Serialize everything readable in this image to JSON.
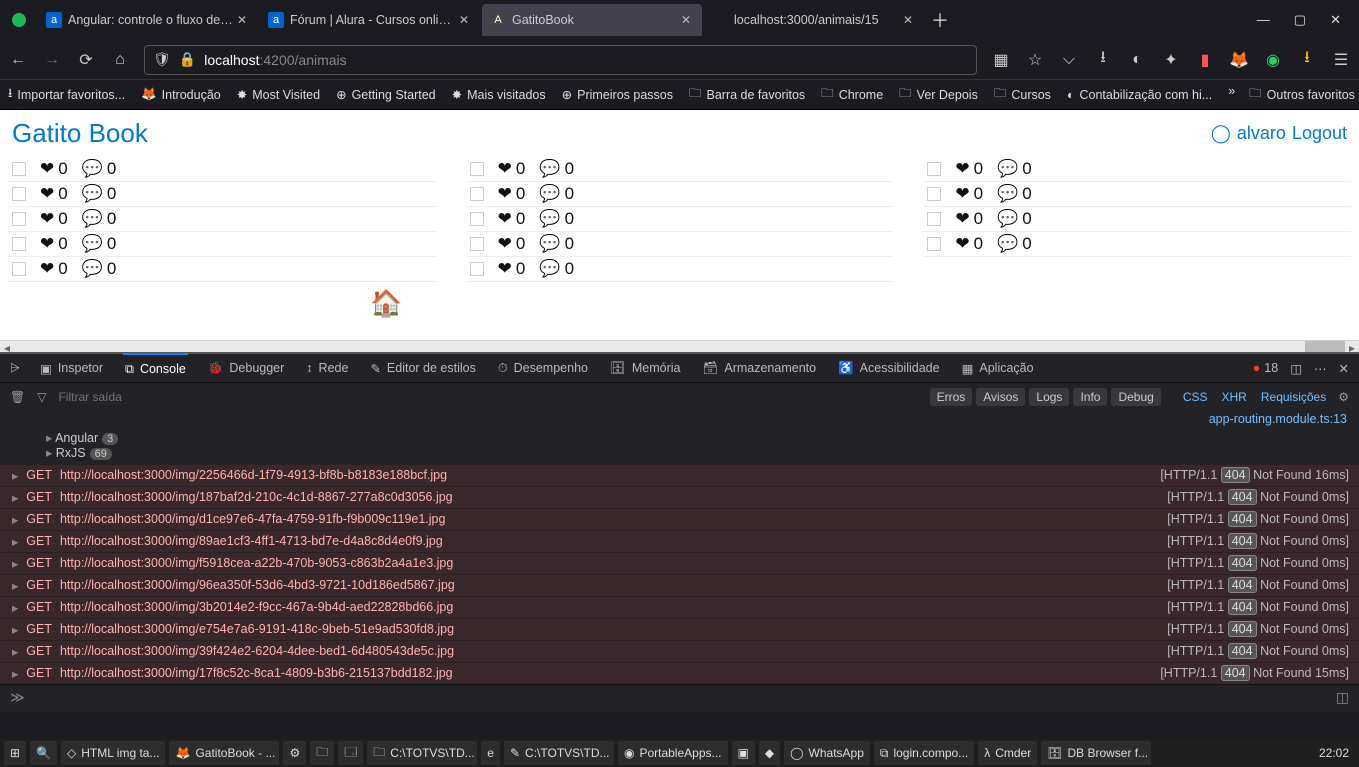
{
  "tabs": [
    {
      "title": "Angular: controle o fluxo de na…",
      "fav": "a",
      "favbg": "#0066cc"
    },
    {
      "title": "Fórum | Alura - Cursos online d…",
      "fav": "a",
      "favbg": "#0066cc"
    },
    {
      "title": "GatitoBook",
      "fav": "A",
      "favbg": "#444",
      "active": true
    },
    {
      "title": "localhost:3000/animais/15",
      "fav": "",
      "favbg": "transparent"
    }
  ],
  "url": {
    "host": "localhost",
    "port": ":4200",
    "path": "/animais"
  },
  "bookmarks": [
    {
      "icon": "⭳",
      "label": "Importar favoritos..."
    },
    {
      "icon": "🦊",
      "label": "Introdução"
    },
    {
      "icon": "✸",
      "label": "Most Visited"
    },
    {
      "icon": "⊕",
      "label": "Getting Started"
    },
    {
      "icon": "✸",
      "label": "Mais visitados"
    },
    {
      "icon": "⊕",
      "label": "Primeiros passos"
    },
    {
      "icon": "🗀",
      "label": "Barra de favoritos"
    },
    {
      "icon": "🗀",
      "label": "Chrome"
    },
    {
      "icon": "🗀",
      "label": "Ver Depois"
    },
    {
      "icon": "🗀",
      "label": "Cursos"
    },
    {
      "icon": "◐",
      "label": "Contabilização com hi..."
    }
  ],
  "bookmarks_right": {
    "more": "»",
    "other": "Outros favoritos"
  },
  "page": {
    "brand": "Gatito Book",
    "user": "alvaro",
    "logout": "Logout",
    "col_counts": [
      5,
      5,
      4
    ],
    "like": "0",
    "comment": "0"
  },
  "devtools": {
    "tabs": [
      "Inspetor",
      "Console",
      "Debugger",
      "Rede",
      "Editor de estilos",
      "Desempenho",
      "Memória",
      "Armazenamento",
      "Acessibilidade",
      "Aplicação"
    ],
    "active": "Console",
    "error_count": "18",
    "filter_placeholder": "Filtrar saída",
    "pills": [
      "Erros",
      "Avisos",
      "Logs",
      "Info",
      "Debug"
    ],
    "links": [
      "CSS",
      "XHR",
      "Requisições"
    ],
    "tree": [
      {
        "label": "Angular",
        "count": "3"
      },
      {
        "label": "RxJS",
        "count": "69"
      }
    ],
    "source_hint": "app-routing.module.ts:13",
    "rows": [
      {
        "url": "http://localhost:3000/img/2256466d-1f79-4913-bf8b-b8183e188bcf.jpg",
        "time": "16ms"
      },
      {
        "url": "http://localhost:3000/img/187baf2d-210c-4c1d-8867-277a8c0d3056.jpg",
        "time": "0ms"
      },
      {
        "url": "http://localhost:3000/img/d1ce97e6-47fa-4759-91fb-f9b009c119e1.jpg",
        "time": "0ms"
      },
      {
        "url": "http://localhost:3000/img/89ae1cf3-4ff1-4713-bd7e-d4a8c8d4e0f9.jpg",
        "time": "0ms"
      },
      {
        "url": "http://localhost:3000/img/f5918cea-a22b-470b-9053-c863b2a4a1e3.jpg",
        "time": "0ms"
      },
      {
        "url": "http://localhost:3000/img/96ea350f-53d6-4bd3-9721-10d186ed5867.jpg",
        "time": "0ms"
      },
      {
        "url": "http://localhost:3000/img/3b2014e2-f9cc-467a-9b4d-aed22828bd66.jpg",
        "time": "0ms"
      },
      {
        "url": "http://localhost:3000/img/e754e7a6-9191-418c-9beb-51e9ad530fd8.jpg",
        "time": "0ms"
      },
      {
        "url": "http://localhost:3000/img/39f424e2-6204-4dee-bed1-6d480543de5c.jpg",
        "time": "0ms"
      },
      {
        "url": "http://localhost:3000/img/17f8c52c-8ca1-4809-b3b6-215137bdd182.jpg",
        "time": "15ms"
      }
    ],
    "method": "GET",
    "proto": "[HTTP/1.1",
    "code": "404",
    "status": "Not Found",
    "end": "]"
  },
  "taskbar": {
    "items": [
      {
        "icon": "⊞",
        "label": ""
      },
      {
        "icon": "🔍",
        "label": ""
      },
      {
        "icon": "◇",
        "label": "HTML img ta..."
      },
      {
        "icon": "🦊",
        "label": "GatitoBook - ..."
      },
      {
        "icon": "⚙",
        "label": ""
      },
      {
        "icon": "🗀",
        "label": ""
      },
      {
        "icon": "🗔",
        "label": ""
      },
      {
        "icon": "🗀",
        "label": "C:\\TOTVS\\TD..."
      },
      {
        "icon": "e",
        "label": ""
      },
      {
        "icon": "✎",
        "label": "C:\\TOTVS\\TD..."
      },
      {
        "icon": "◉",
        "label": "PortableApps..."
      },
      {
        "icon": "▣",
        "label": ""
      },
      {
        "icon": "◆",
        "label": ""
      },
      {
        "icon": "◯",
        "label": "WhatsApp"
      },
      {
        "icon": "⧉",
        "label": "login.compo..."
      },
      {
        "icon": "λ",
        "label": "Cmder"
      },
      {
        "icon": "🗄",
        "label": "DB Browser f..."
      }
    ],
    "clock": "22:02"
  }
}
